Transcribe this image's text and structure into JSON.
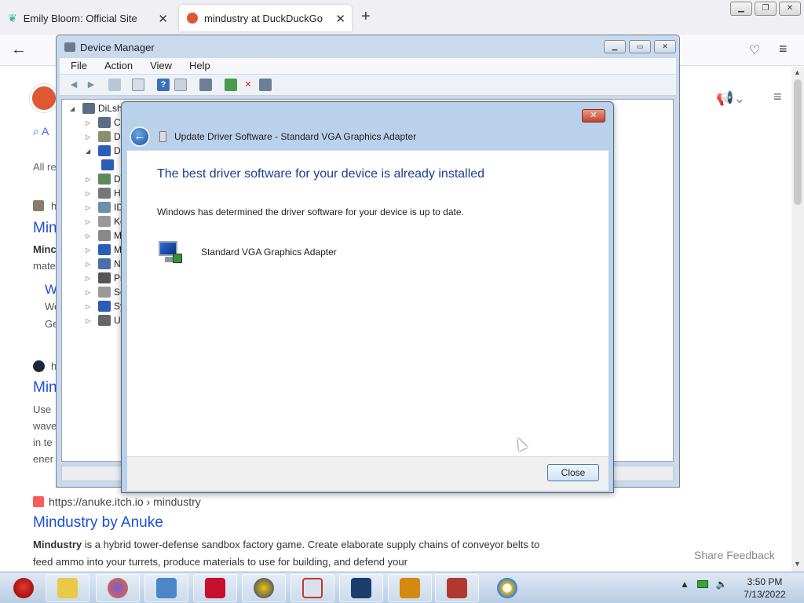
{
  "browser": {
    "tabs": [
      {
        "title": "Emily Bloom: Official Site",
        "active": false
      },
      {
        "title": "mindustry at DuckDuckGo",
        "active": true
      }
    ],
    "new_tab": "+",
    "close_glyph": "✕"
  },
  "page": {
    "tab_all_fragment": "A",
    "all_regions_fragment": "All re",
    "left_fragments": [
      "h",
      "Min",
      "Minc",
      "mate",
      "W",
      "We",
      "Ge",
      "h",
      "Min",
      "Use",
      "wave",
      "in te",
      "ener"
    ],
    "result": {
      "url": "https://anuke.itch.io › mindustry",
      "title": "Mindustry by Anuke",
      "snippet_bold": "Mindustry",
      "snippet_rest": " is a hybrid tower-defense sandbox factory game. Create elaborate supply chains of conveyor belts to feed ammo into your turrets, produce materials to use for building, and defend your"
    },
    "share_feedback": "Share Feedback"
  },
  "device_manager": {
    "title": "Device Manager",
    "menu": [
      "File",
      "Action",
      "View",
      "Help"
    ],
    "tree_root": "DiLsh",
    "tree_items": [
      "Co",
      "Di",
      "Di",
      "",
      "DV",
      "Hu",
      "ID",
      "Ke",
      "Mi",
      "Mo",
      "Ne",
      "Pr",
      "So",
      "Sy",
      "Ur"
    ]
  },
  "dialog": {
    "title": "Update Driver Software - Standard VGA Graphics Adapter",
    "heading": "The best driver software for your device is already installed",
    "description": "Windows has determined the driver software for your device is up to date.",
    "device_name": "Standard VGA Graphics Adapter",
    "close_button": "Close"
  },
  "taskbar": {
    "time": "3:50 PM",
    "date": "7/13/2022"
  }
}
